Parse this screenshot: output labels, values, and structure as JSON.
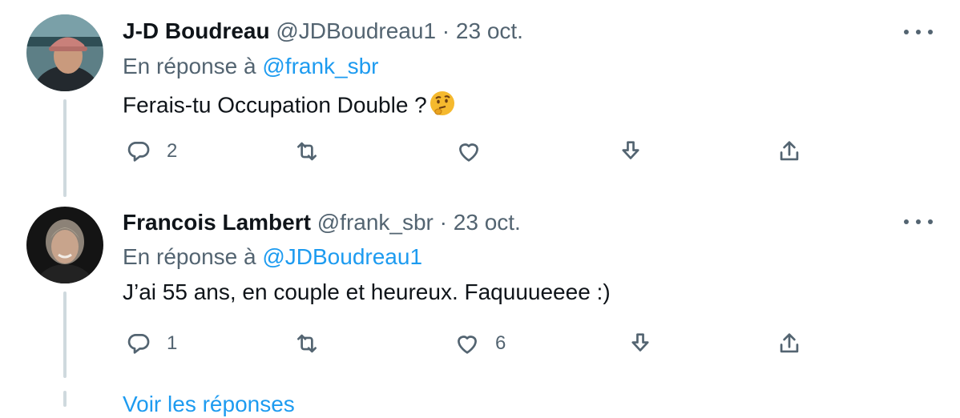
{
  "tweets": [
    {
      "name": "J-D Boudreau",
      "handle": "@JDBoudreau1",
      "separator": "·",
      "date": "23 oct.",
      "reply_prefix": "En réponse à",
      "reply_to": "@frank_sbr",
      "text": "Ferais-tu Occupation Double ?",
      "emoji": "thinking-face",
      "actions": {
        "replies": "2",
        "retweets": "",
        "likes": ""
      }
    },
    {
      "name": "Francois Lambert",
      "handle": "@frank_sbr",
      "separator": "·",
      "date": "23 oct.",
      "reply_prefix": "En réponse à",
      "reply_to": "@JDBoudreau1",
      "text": "J’ai 55 ans, en couple et heureux. Faquuueeee :)",
      "actions": {
        "replies": "1",
        "retweets": "",
        "likes": "6"
      }
    }
  ],
  "footer_link": "Voir les réponses",
  "colors": {
    "link": "#1d9bf0",
    "secondary": "#536471",
    "text": "#0f1419",
    "thread_line": "#cfd9de"
  }
}
